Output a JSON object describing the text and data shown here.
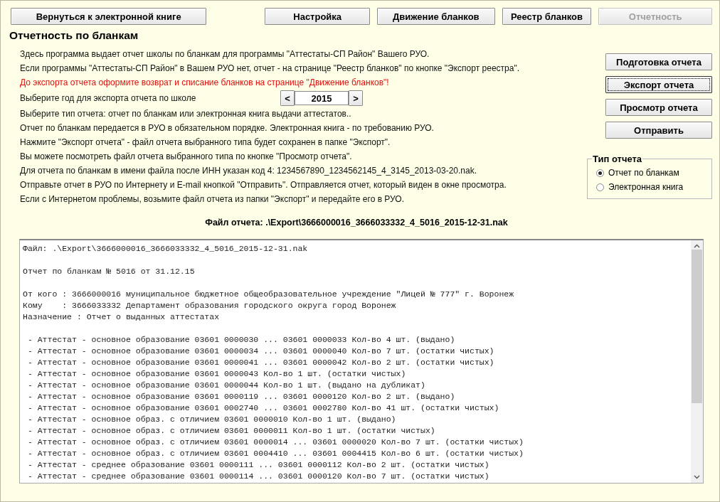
{
  "top_buttons": [
    {
      "label": "Вернуться к электронной книге",
      "disabled": false
    },
    {
      "label": "Настройка",
      "disabled": false
    },
    {
      "label": "Движение бланков",
      "disabled": false
    },
    {
      "label": "Реестр бланков",
      "disabled": false
    },
    {
      "label": "Отчетность",
      "disabled": true
    }
  ],
  "title": "Отчетность по бланкам",
  "instructions": [
    {
      "kind": "text",
      "text": "Здесь программа выдает отчет школы по бланкам для программы \"Аттестаты-СП Район\" Вашего РУО."
    },
    {
      "kind": "text",
      "text": "Если программы \"Аттестаты-СП Район\" в Вашем РУО нет, отчет - на странице \"Реестр бланков\" по кнопке \"Экспорт реестра\"."
    },
    {
      "kind": "warning",
      "text": "До экспорта отчета оформите возврат и списание бланков на странице \"Движение бланков\"!"
    },
    {
      "kind": "year-picker",
      "text": "Выберите год для экспорта отчета по школе",
      "prev": "<",
      "value": "2015",
      "next": ">"
    },
    {
      "kind": "text",
      "text": "Выберите тип отчета: отчет по бланкам или электронная книга выдачи аттестатов.."
    },
    {
      "kind": "text",
      "text": "Отчет по бланкам передается в РУО в обязательном порядке. Электронная книга - по требованию РУО."
    },
    {
      "kind": "text",
      "text": "Нажмите \"Экспорт отчета\" - файл отчета выбранного типа будет сохранен в папке \"Экспорт\"."
    },
    {
      "kind": "text",
      "text": "Вы можете посмотреть файл отчета выбранного типа по кнопке \"Просмотр отчета\"."
    },
    {
      "kind": "text",
      "text": "Для отчета по бланкам в имени файла после ИНН указан код 4: 1234567890_1234562145_4_3145_2013-03-20.nak."
    },
    {
      "kind": "text",
      "text": "Отправьте отчет в РУО по Интернету и E-mail кнопкой \"Отправить\". Отправляется отчет, который виден в окне просмотра."
    },
    {
      "kind": "text",
      "text": "Если с Интернетом проблемы, возьмите файл отчета из папки \"Экспорт\" и передайте его в РУО."
    }
  ],
  "side_buttons": [
    {
      "label": "Подготовка отчета",
      "focused": false
    },
    {
      "label": "Экспорт отчета",
      "focused": true
    },
    {
      "label": "Просмотр отчета",
      "focused": false
    },
    {
      "label": "Отправить",
      "focused": false
    }
  ],
  "report_type": {
    "title": "Тип отчета",
    "options": [
      {
        "label": "Отчет по бланкам",
        "selected": true
      },
      {
        "label": "Электронная книга",
        "selected": false
      }
    ]
  },
  "file_label": "Файл отчета: .\\Export\\3666000016_3666033332_4_5016_2015-12-31.nak",
  "viewer": {
    "blocks": [
      [
        "Файл: .\\Export\\3666000016_3666033332_4_5016_2015-12-31.nak"
      ],
      [
        "Отчет по бланкам № 5016 от 31.12.15"
      ],
      [
        "От кого : 3666000016 муниципальное бюджетное общеобразовательное учреждение \"Лицей № 777\" г. Воронеж",
        "Кому    : 3666033332 Департамент образования городского округа город Воронеж",
        "Назначение : Отчет о выданных аттестатах"
      ],
      [
        " - Аттестат - основное образование 03601 0000030 ... 03601 0000033 Кол-во 4 шт. (выдано)",
        " - Аттестат - основное образование 03601 0000034 ... 03601 0000040 Кол-во 7 шт. (остатки чистых)",
        " - Аттестат - основное образование 03601 0000041 ... 03601 0000042 Кол-во 2 шт. (остатки чистых)",
        " - Аттестат - основное образование 03601 0000043 Кол-во 1 шт. (остатки чистых)",
        " - Аттестат - основное образование 03601 0000044 Кол-во 1 шт. (выдано на дубликат)",
        " - Аттестат - основное образование 03601 0000119 ... 03601 0000120 Кол-во 2 шт. (выдано)",
        " - Аттестат - основное образование 03601 0002740 ... 03601 0002780 Кол-во 41 шт. (остатки чистых)",
        " - Аттестат - основное образ. с отличием 03601 0000010 Кол-во 1 шт. (выдано)",
        " - Аттестат - основное образ. с отличием 03601 0000011 Кол-во 1 шт. (остатки чистых)",
        " - Аттестат - основное образ. с отличием 03601 0000014 ... 03601 0000020 Кол-во 7 шт. (остатки чистых)",
        " - Аттестат - основное образ. с отличием 03601 0004410 ... 03601 0004415 Кол-во 6 шт. (остатки чистых)",
        " - Аттестат - среднее образование 03601 0000111 ... 03601 0000112 Кол-во 2 шт. (остатки чистых)",
        " - Аттестат - среднее образование 03601 0000114 ... 03601 0000120 Кол-во 7 шт. (остатки чистых)"
      ]
    ]
  }
}
